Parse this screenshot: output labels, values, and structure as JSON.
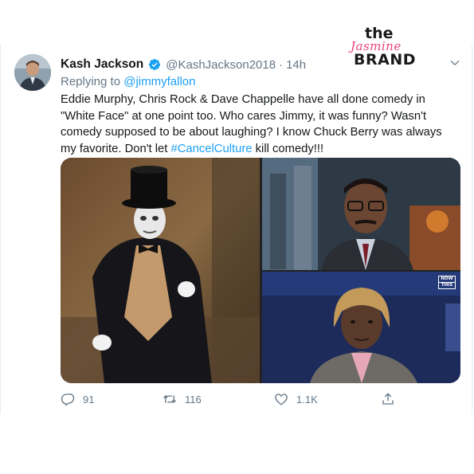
{
  "author": {
    "display_name": "Kash Jackson",
    "handle": "@KashJackson2018",
    "separator": "·",
    "time": "14h",
    "verified_icon": "verified-badge-icon",
    "avatar_icon": "profile-avatar"
  },
  "reply": {
    "prefix": "Replying to",
    "mention": "@jimmyfallon"
  },
  "tweet": {
    "text_before_hashtag": "Eddie Murphy, Chris Rock & Dave Chappelle have all done comedy in \"White Face\" at one point too. Who cares Jimmy, it was funny? Wasn't comedy supposed to be about laughing? I know Chuck Berry was always my favorite. Don't let ",
    "hashtag": "#CancelCulture",
    "text_after_hashtag": " kill comedy!!!"
  },
  "media": {
    "overlay_logo_line1": "NOW",
    "overlay_logo_line2": "THIS"
  },
  "actions": {
    "reply_count": "91",
    "retweet_count": "116",
    "like_count": "1.1K",
    "icons": [
      "reply-icon",
      "retweet-icon",
      "like-icon",
      "share-icon"
    ]
  },
  "watermark": {
    "line1": "the",
    "line2": "Jasmine",
    "line3": "BRAND"
  },
  "colors": {
    "link": "#1da1f2",
    "muted": "#657786",
    "text": "#14171a",
    "watermark_accent": "#ee3f7a"
  }
}
